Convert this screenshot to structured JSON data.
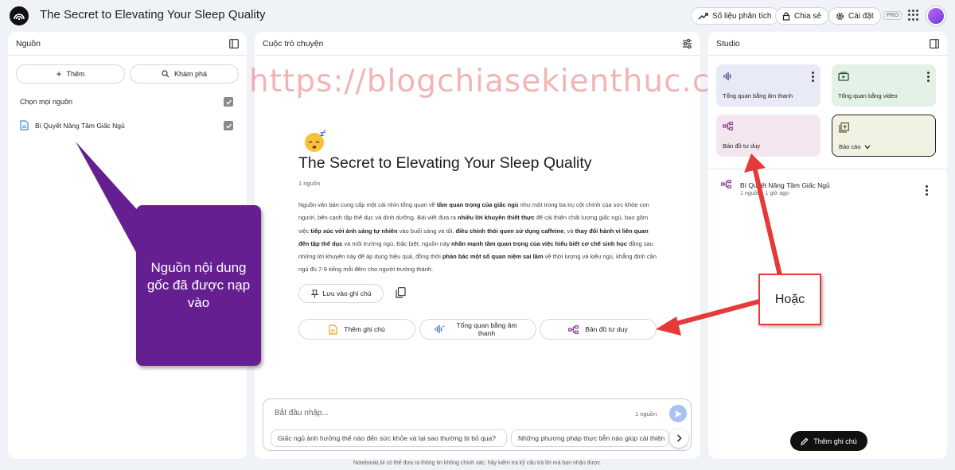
{
  "header": {
    "title": "The Secret to Elevating Your Sleep Quality",
    "analytics_label": "Số liệu phân tích",
    "share_label": "Chia sẻ",
    "settings_label": "Cài đặt",
    "pro_badge": "PRO"
  },
  "sources": {
    "panel_title": "Nguồn",
    "add_label": "Thêm",
    "discover_label": "Khám phá",
    "select_all_label": "Chọn mọi nguồn",
    "items": [
      {
        "label": "Bí Quyết Nâng Tầm Giấc Ngủ",
        "checked": true
      }
    ]
  },
  "chat": {
    "panel_title": "Cuộc trò chuyện",
    "notebook_title": "The Secret to Elevating Your Sleep Quality",
    "source_count": "1 nguồn",
    "summary_parts": [
      {
        "t": "Nguồn văn bản cung cấp một cái nhìn tổng quan về ",
        "b": false
      },
      {
        "t": "tầm quan trọng của giấc ngủ",
        "b": true
      },
      {
        "t": " như một trong ba trụ cột chính của sức khỏe con người, bên cạnh tập thể dục và dinh dưỡng. Bài viết đưa ra ",
        "b": false
      },
      {
        "t": "nhiều lời khuyên thiết thực",
        "b": true
      },
      {
        "t": " để cải thiện chất lượng giấc ngủ, bao gồm việc ",
        "b": false
      },
      {
        "t": "tiếp xúc với ánh sáng tự nhiên",
        "b": true
      },
      {
        "t": " vào buổi sáng và tối, ",
        "b": false
      },
      {
        "t": "điều chỉnh thói quen sử dụng caffeine",
        "b": true
      },
      {
        "t": ", và ",
        "b": false
      },
      {
        "t": "thay đổi hành vi liên quan đến tập thể dục",
        "b": true
      },
      {
        "t": " và môi trường ngủ. Đặc biệt, nguồn này ",
        "b": false
      },
      {
        "t": "nhấn mạnh tầm quan trọng của việc hiểu biết cơ chế sinh học",
        "b": true
      },
      {
        "t": " đằng sau những lời khuyên này để áp dụng hiệu quả, đồng thời ",
        "b": false
      },
      {
        "t": "phản bác một số quan niệm sai lầm",
        "b": true
      },
      {
        "t": " về thời lượng và kiểu ngủ, khẳng định cần ngủ đủ 7-9 tiếng mỗi đêm cho người trưởng thành.",
        "b": false
      }
    ],
    "save_note_label": "Lưu vào ghi chú",
    "actions": [
      {
        "label": "Thêm ghi chú",
        "icon": "note-icon"
      },
      {
        "label": "Tổng quan bằng âm thanh",
        "icon": "audio-wave-icon"
      },
      {
        "label": "Bản đồ tư duy",
        "icon": "mind-map-icon"
      }
    ],
    "input_placeholder": "Bắt đầu nhập...",
    "input_source_count": "1 nguồn",
    "suggestions": [
      "Giấc ngủ ảnh hưởng thế nào đến sức khỏe và tại sao thường bị bỏ qua?",
      "Những phương pháp thực tiễn nào giúp cải thiện"
    ],
    "watermark": "https://blogchiasekienthuc.com/"
  },
  "studio": {
    "panel_title": "Studio",
    "tiles": [
      {
        "label": "Tổng quan bằng âm thanh",
        "icon": "audio-wave-icon",
        "bg": "#e8eaf6"
      },
      {
        "label": "Tổng quan bằng video",
        "icon": "video-icon",
        "bg": "#e3f1e6"
      },
      {
        "label": "Bản đồ tư duy",
        "icon": "mind-map-icon",
        "bg": "#f3e6ef"
      },
      {
        "label": "Báo cáo",
        "icon": "report-icon",
        "bg": "#f1f1e4"
      }
    ],
    "note": {
      "title": "Bí Quyết Nâng Tầm Giấc Ngủ",
      "subtitle": "1 nguồn · 1 giờ ago"
    },
    "add_note_label": "Thêm ghi chú"
  },
  "annotations": {
    "callout_text": "Nguồn nội dung gốc đã được nạp vào",
    "hoac_text": "Hoặc",
    "callout_color": "#661f90",
    "arrow_color": "#e43a3a"
  },
  "footer": "NotebookLM có thể đưa ra thông tin không chính xác; hãy kiểm tra kỹ câu trả lời mà bạn nhận được."
}
